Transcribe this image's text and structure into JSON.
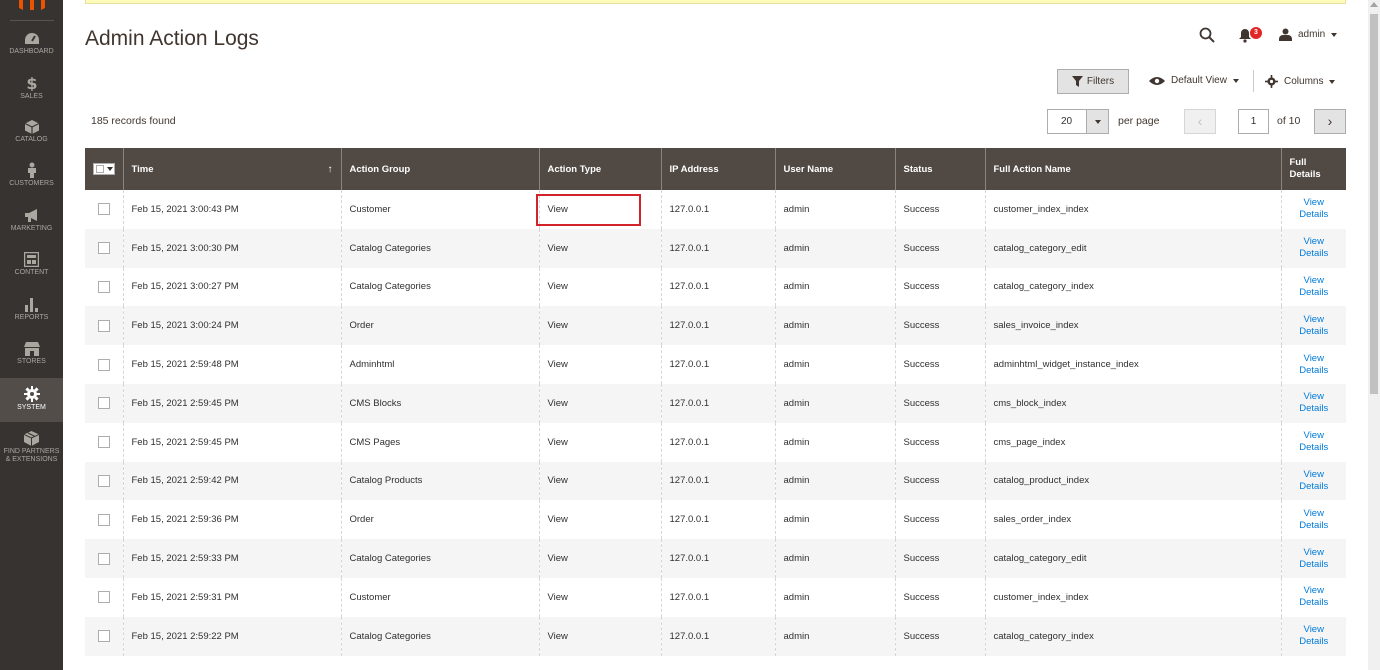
{
  "sidebar": {
    "items": [
      {
        "label": "Dashboard",
        "icon": "dashboard-icon"
      },
      {
        "label": "Sales",
        "icon": "dollar-icon"
      },
      {
        "label": "Catalog",
        "icon": "cube-icon"
      },
      {
        "label": "Customers",
        "icon": "person-icon"
      },
      {
        "label": "Marketing",
        "icon": "megaphone-icon"
      },
      {
        "label": "Content",
        "icon": "layout-icon"
      },
      {
        "label": "Reports",
        "icon": "bar-chart-icon"
      },
      {
        "label": "Stores",
        "icon": "storefront-icon"
      },
      {
        "label": "System",
        "icon": "gear-icon",
        "active": true
      },
      {
        "label": "Find Partners & Extensions",
        "icon": "box-icon"
      }
    ]
  },
  "header": {
    "title": "Admin Action Logs",
    "notification_count": "3",
    "user": "admin"
  },
  "toolbar": {
    "filters_label": "Filters",
    "view_label": "Default View",
    "columns_label": "Columns",
    "records_found": "185 records found",
    "per_page_value": "20",
    "per_page_label": "per page",
    "current_page": "1",
    "total_pages_label": "of 10"
  },
  "grid": {
    "columns": [
      "Time",
      "Action Group",
      "Action Type",
      "IP Address",
      "User Name",
      "Status",
      "Full Action Name",
      "Full Details"
    ],
    "rows": [
      {
        "time": "Feb 15, 2021 3:00:43 PM",
        "group": "Customer",
        "type": "View",
        "ip": "127.0.0.1",
        "user": "admin",
        "status": "Success",
        "action": "customer_index_index",
        "details": "View Details"
      },
      {
        "time": "Feb 15, 2021 3:00:30 PM",
        "group": "Catalog Categories",
        "type": "View",
        "ip": "127.0.0.1",
        "user": "admin",
        "status": "Success",
        "action": "catalog_category_edit",
        "details": "View Details"
      },
      {
        "time": "Feb 15, 2021 3:00:27 PM",
        "group": "Catalog Categories",
        "type": "View",
        "ip": "127.0.0.1",
        "user": "admin",
        "status": "Success",
        "action": "catalog_category_index",
        "details": "View Details"
      },
      {
        "time": "Feb 15, 2021 3:00:24 PM",
        "group": "Order",
        "type": "View",
        "ip": "127.0.0.1",
        "user": "admin",
        "status": "Success",
        "action": "sales_invoice_index",
        "details": "View Details"
      },
      {
        "time": "Feb 15, 2021 2:59:48 PM",
        "group": "Adminhtml",
        "type": "View",
        "ip": "127.0.0.1",
        "user": "admin",
        "status": "Success",
        "action": "adminhtml_widget_instance_index",
        "details": "View Details"
      },
      {
        "time": "Feb 15, 2021 2:59:45 PM",
        "group": "CMS Blocks",
        "type": "View",
        "ip": "127.0.0.1",
        "user": "admin",
        "status": "Success",
        "action": "cms_block_index",
        "details": "View Details"
      },
      {
        "time": "Feb 15, 2021 2:59:45 PM",
        "group": "CMS Pages",
        "type": "View",
        "ip": "127.0.0.1",
        "user": "admin",
        "status": "Success",
        "action": "cms_page_index",
        "details": "View Details"
      },
      {
        "time": "Feb 15, 2021 2:59:42 PM",
        "group": "Catalog Products",
        "type": "View",
        "ip": "127.0.0.1",
        "user": "admin",
        "status": "Success",
        "action": "catalog_product_index",
        "details": "View Details"
      },
      {
        "time": "Feb 15, 2021 2:59:36 PM",
        "group": "Order",
        "type": "View",
        "ip": "127.0.0.1",
        "user": "admin",
        "status": "Success",
        "action": "sales_order_index",
        "details": "View Details"
      },
      {
        "time": "Feb 15, 2021 2:59:33 PM",
        "group": "Catalog Categories",
        "type": "View",
        "ip": "127.0.0.1",
        "user": "admin",
        "status": "Success",
        "action": "catalog_category_edit",
        "details": "View Details"
      },
      {
        "time": "Feb 15, 2021 2:59:31 PM",
        "group": "Customer",
        "type": "View",
        "ip": "127.0.0.1",
        "user": "admin",
        "status": "Success",
        "action": "customer_index_index",
        "details": "View Details"
      },
      {
        "time": "Feb 15, 2021 2:59:22 PM",
        "group": "Catalog Categories",
        "type": "View",
        "ip": "127.0.0.1",
        "user": "admin",
        "status": "Success",
        "action": "catalog_category_index",
        "details": "View Details"
      }
    ]
  },
  "colors": {
    "sidebar_bg": "#373330",
    "header_bg": "#514943",
    "link": "#007bdb",
    "highlight": "#d2232a",
    "badge": "#e22626"
  }
}
